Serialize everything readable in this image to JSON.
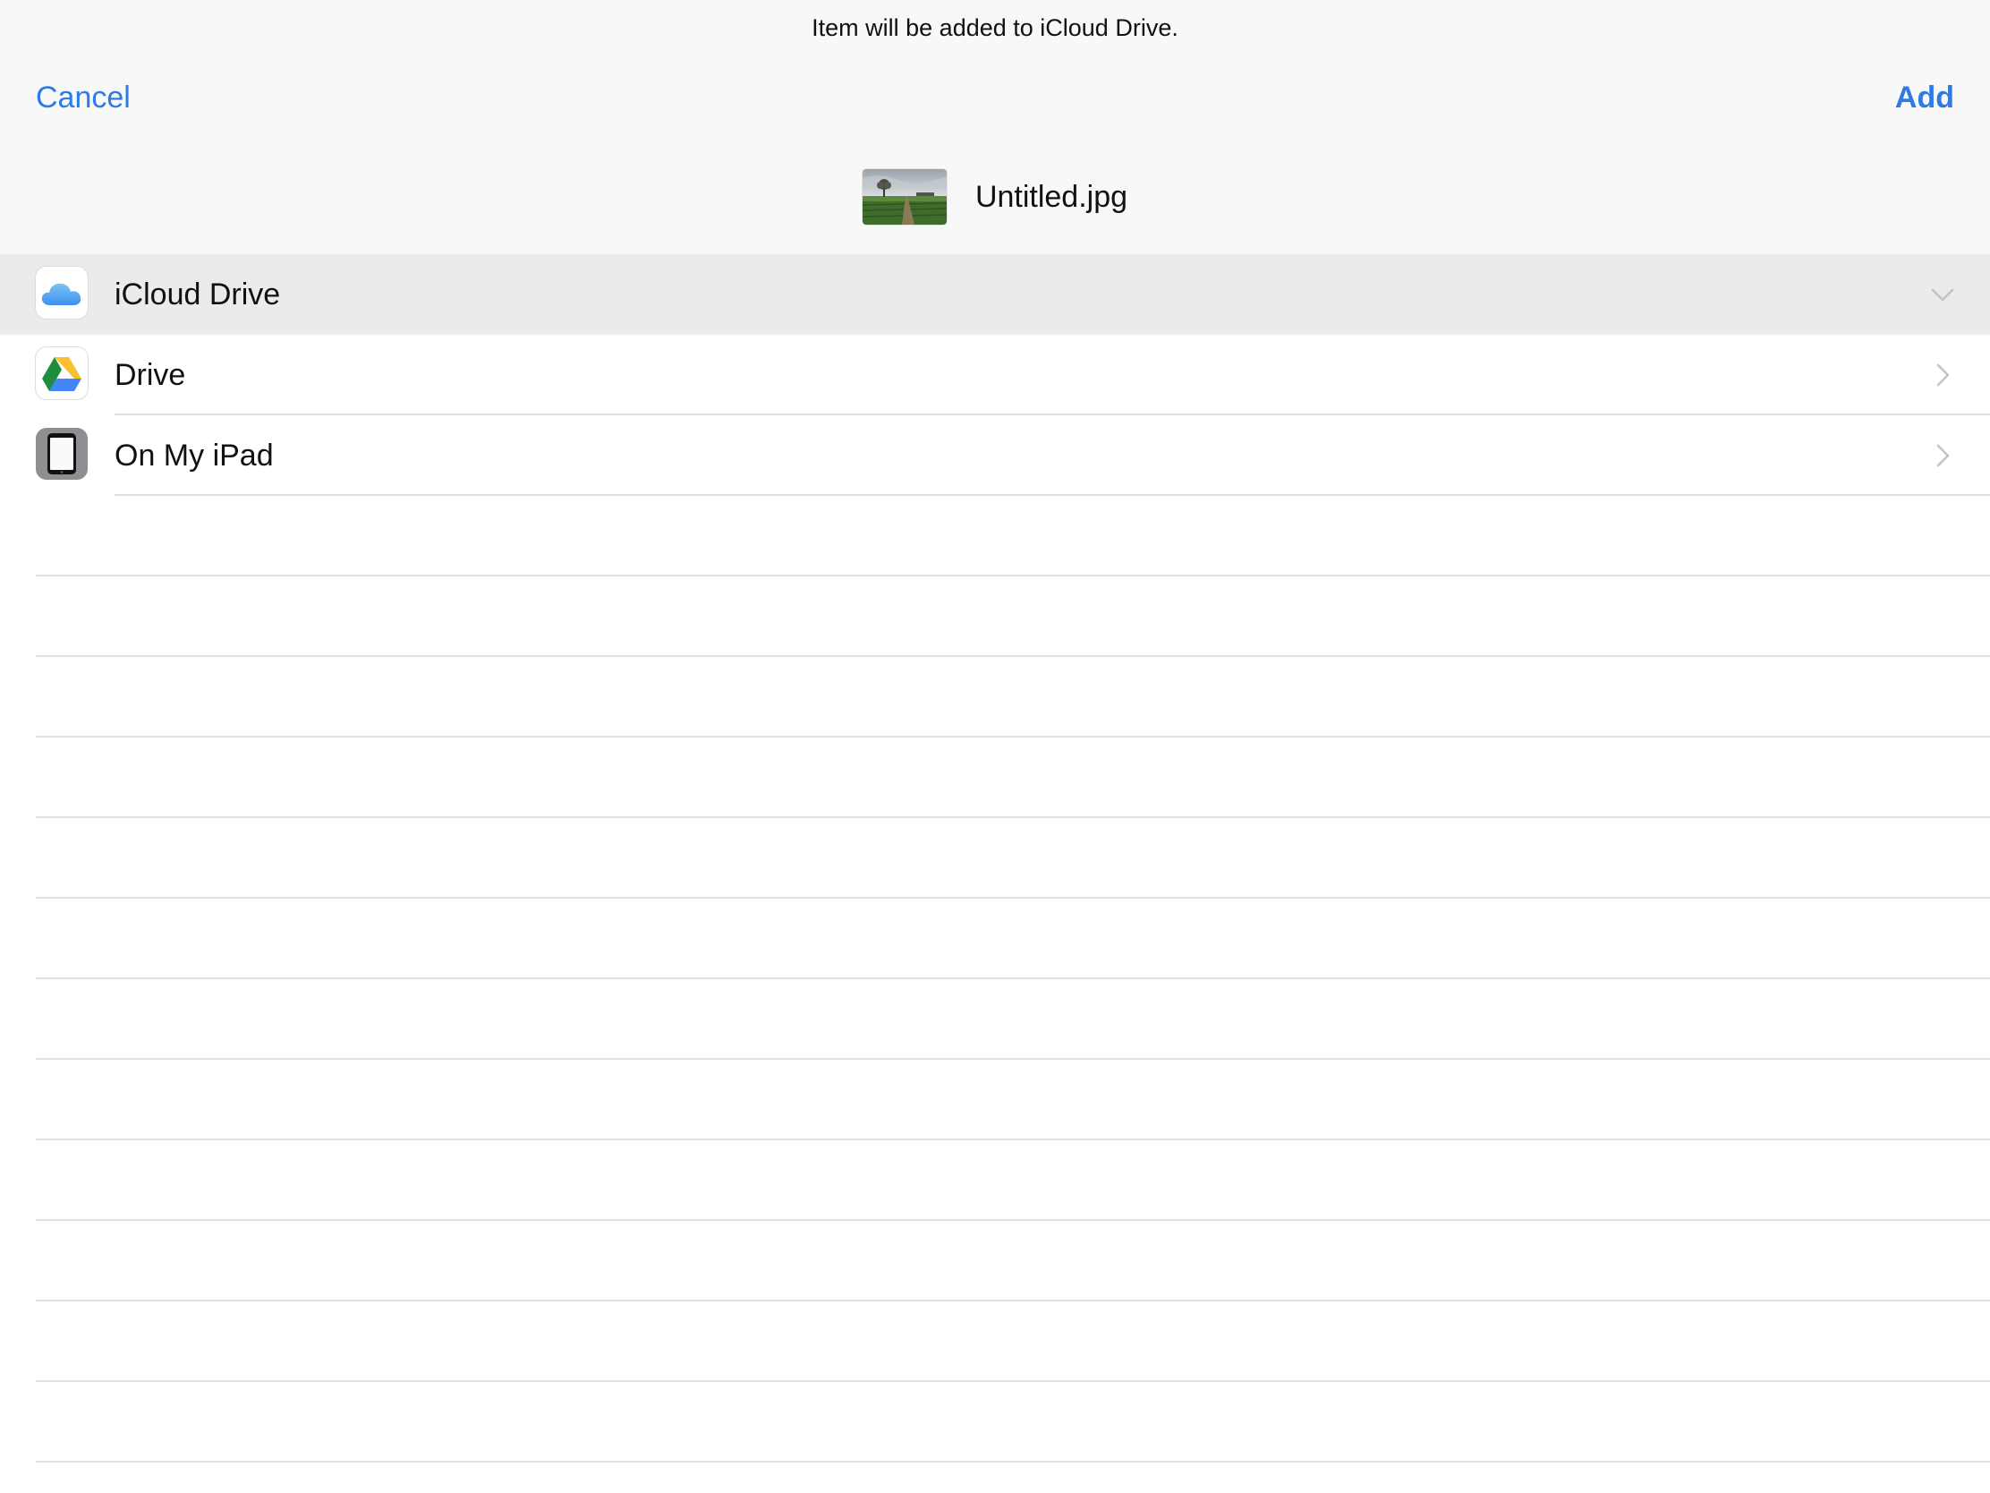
{
  "header": {
    "message": "Item will be added to iCloud Drive.",
    "cancel_label": "Cancel",
    "add_label": "Add",
    "filename": "Untitled.jpg"
  },
  "locations": [
    {
      "label": "iCloud Drive",
      "icon": "icloud-icon",
      "chevron": "chevron-down-icon",
      "selected": true
    },
    {
      "label": "Drive",
      "icon": "google-drive-icon",
      "chevron": "chevron-right-icon",
      "selected": false
    },
    {
      "label": "On My iPad",
      "icon": "ipad-icon",
      "chevron": "chevron-right-icon",
      "selected": false
    }
  ],
  "colors": {
    "accent": "#2f7be6",
    "header_bg": "#f8f8f8",
    "selected_row_bg": "#ebebeb",
    "separator": "#dedede"
  }
}
